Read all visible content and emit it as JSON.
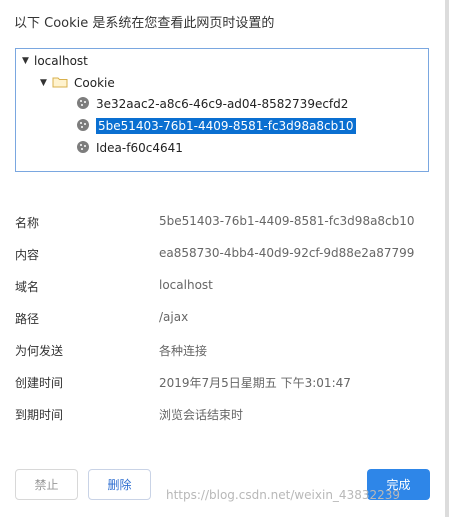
{
  "dialog": {
    "title": "以下 Cookie 是系统在您查看此网页时设置的"
  },
  "tree": {
    "root": "localhost",
    "folder": "Cookie",
    "cookies": [
      "3e32aac2-a8c6-46c9-ad04-8582739ecfd2",
      "5be51403-76b1-4409-8581-fc3d98a8cb10",
      "Idea-f60c4641"
    ],
    "selected_index": 1
  },
  "details": {
    "name_label": "名称",
    "name_value": "5be51403-76b1-4409-8581-fc3d98a8cb10",
    "content_label": "内容",
    "content_value": "ea858730-4bb4-40d9-92cf-9d88e2a87799",
    "domain_label": "域名",
    "domain_value": "localhost",
    "path_label": "路径",
    "path_value": "/ajax",
    "send_label": "为何发送",
    "send_value": "各种连接",
    "created_label": "创建时间",
    "created_value": "2019年7月5日星期五 下午3:01:47",
    "expires_label": "到期时间",
    "expires_value": "浏览会话结束时"
  },
  "buttons": {
    "block": "禁止",
    "delete": "删除",
    "done": "完成"
  },
  "watermark": "https://blog.csdn.net/weixin_43832239",
  "colors": {
    "selection": "#0a6fd1",
    "primary": "#2e86e8",
    "tree_border": "#7aa7e0"
  }
}
